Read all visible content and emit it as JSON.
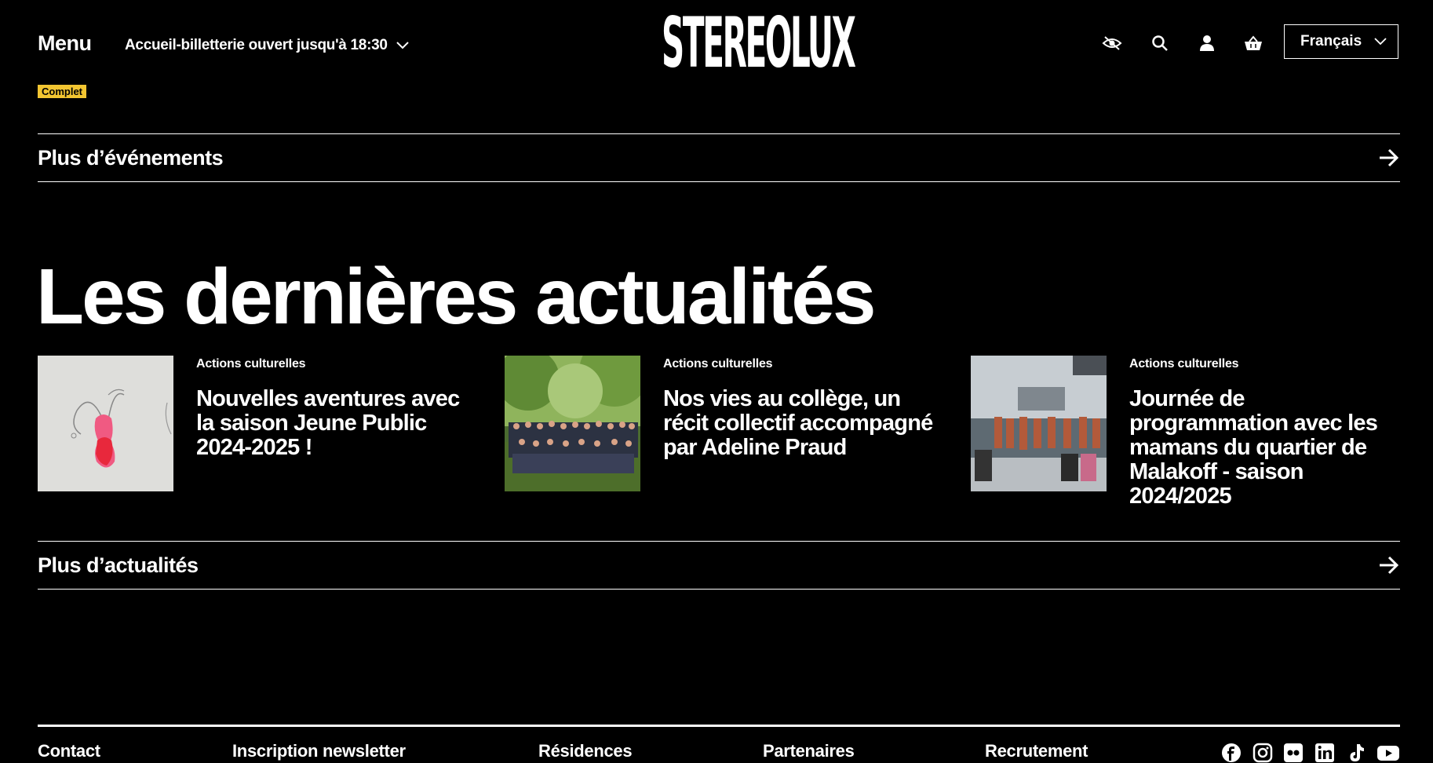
{
  "header": {
    "menu_label": "Menu",
    "hours_text": "Accueil-billetterie ouvert jusqu'à 18:30",
    "logo_text": "STEREOLUX",
    "language_selected": "Français",
    "icons": [
      "visibility-off-icon",
      "search-icon",
      "user-icon",
      "basket-icon"
    ]
  },
  "events": {
    "badge": "Complet",
    "more_label": "Plus d’événements"
  },
  "news": {
    "title": "Les dernières actualités",
    "items": [
      {
        "category": "Actions culturelles",
        "title": "Nouvelles aventures avec la saison Jeune Public 2024-2025 !"
      },
      {
        "category": "Actions culturelles",
        "title": "Nos vies au collège, un récit collectif accompagné par Adeline Praud"
      },
      {
        "category": "Actions culturelles",
        "title": "Journée de programmation avec les mamans du quartier de Malakoff - saison 2024/2025"
      }
    ],
    "more_label": "Plus d’actualités"
  },
  "footer": {
    "links": [
      "Contact",
      "Inscription newsletter",
      "Résidences",
      "Partenaires",
      "Recrutement"
    ],
    "social_icons": [
      "facebook-icon",
      "instagram-icon",
      "flickr-icon",
      "linkedin-icon",
      "tiktok-icon",
      "youtube-icon"
    ]
  },
  "colors": {
    "background": "#000000",
    "text": "#ffffff",
    "badge": "#f2c531"
  }
}
